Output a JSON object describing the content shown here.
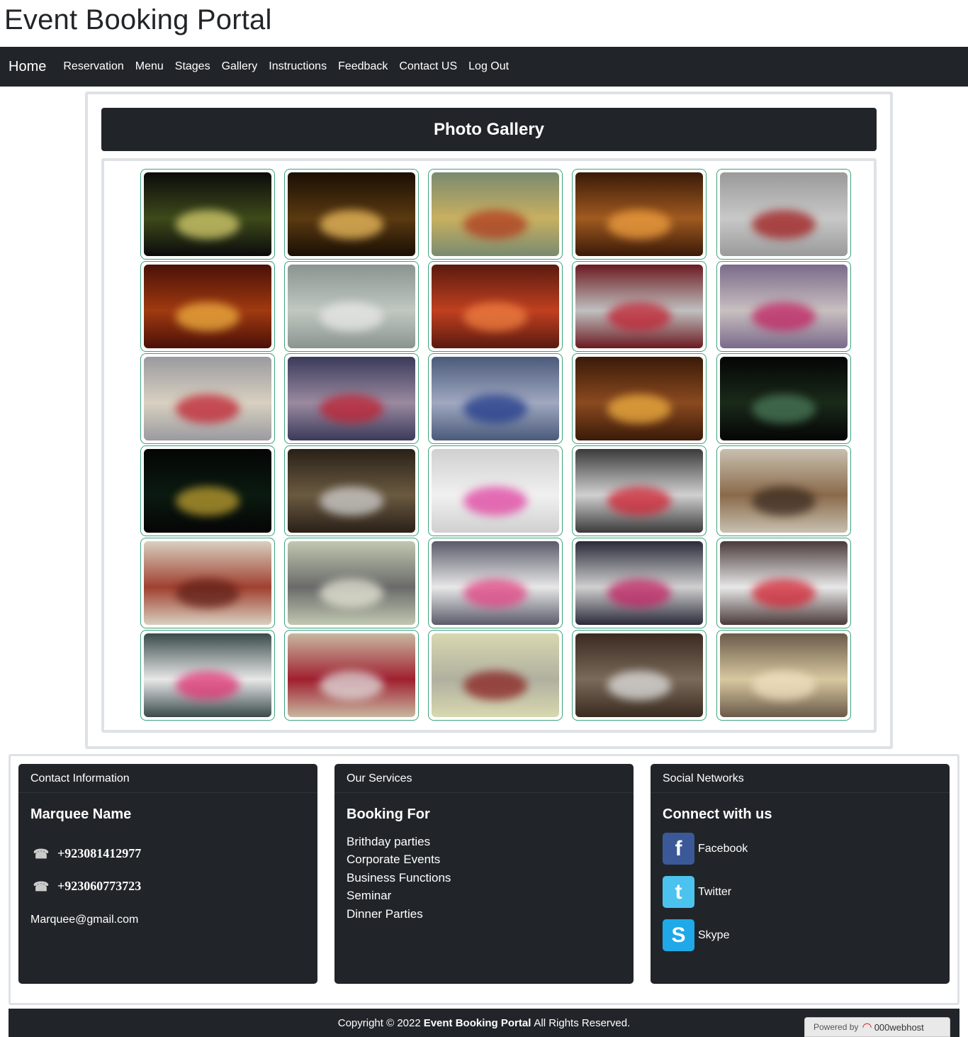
{
  "site": {
    "title": "Event Booking Portal"
  },
  "nav": {
    "brand": "Home",
    "links": [
      "Reservation",
      "Menu",
      "Stages",
      "Gallery",
      "Instructions",
      "Feedback",
      "Contact US",
      "Log Out"
    ]
  },
  "gallery": {
    "title": "Photo Gallery",
    "photo_count": 30
  },
  "footer": {
    "contact": {
      "header": "Contact Information",
      "title": "Marquee Name",
      "phones": [
        "+923081412977",
        "+923060773723"
      ],
      "email": "Marquee@gmail.com"
    },
    "services": {
      "header": "Our Services",
      "title": "Booking For",
      "items": [
        "Brithday parties",
        "Corporate Events",
        "Business Functions",
        "Seminar",
        "Dinner Parties"
      ]
    },
    "social": {
      "header": "Social Networks",
      "title": "Connect with us",
      "links": [
        "Facebook",
        "Twitter",
        "Skype"
      ]
    },
    "copyright_prefix": "Copyright © 2022",
    "copyright_brand": "Event Booking Portal",
    "copyright_suffix": "All Rights Reserved.",
    "powered_by": "Powered by",
    "host": "000webhost"
  },
  "colors": {
    "dark": "#212529",
    "thumb_border": "#3aa37a",
    "panel_border": "#dee2e6",
    "facebook": "#3b5998",
    "twitter": "#4cc3ef",
    "skype": "#1fa9e8"
  },
  "icons": [
    "phone-icon",
    "facebook-icon",
    "twitter-icon",
    "skype-icon"
  ]
}
